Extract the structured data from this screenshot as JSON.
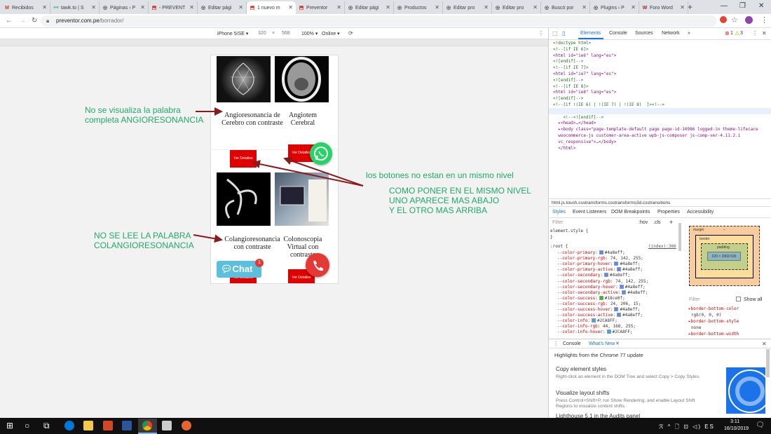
{
  "browser": {
    "tabs": [
      {
        "label": "Recibidos",
        "favicon": "M",
        "active": false
      },
      {
        "label": "tawk.to | S",
        "favicon": "tawk",
        "active": false
      },
      {
        "label": "Páginas ‹ P",
        "favicon": "wp",
        "active": false
      },
      {
        "label": "- PREVENT",
        "favicon": "prev",
        "active": false
      },
      {
        "label": "Editar pági",
        "favicon": "wp",
        "active": false
      },
      {
        "label": "1 nuevo m",
        "favicon": "prev",
        "active": true
      },
      {
        "label": "Preventor",
        "favicon": "prev",
        "active": false
      },
      {
        "label": "Editar pági",
        "favicon": "wp",
        "active": false
      },
      {
        "label": "Productos",
        "favicon": "wp",
        "active": false
      },
      {
        "label": "Editar pro",
        "favicon": "wp",
        "active": false
      },
      {
        "label": "Editar pro",
        "favicon": "wp",
        "active": false
      },
      {
        "label": "Buscó por",
        "favicon": "wp",
        "active": false
      },
      {
        "label": "Plugins ‹ P",
        "favicon": "wp",
        "active": false
      },
      {
        "label": "Foro Word",
        "favicon": "W",
        "active": false
      }
    ],
    "url_domain": "preventor.com.pe",
    "url_path": "/borrador/"
  },
  "device_toolbar": {
    "device": "iPhone 5/SE ▾",
    "width": "320",
    "height": "568",
    "zoom": "100% ▾",
    "network": "Online ▾"
  },
  "products": [
    {
      "title": "Angioresonancia de Cerebro con contraste",
      "button": "Ver Detalles"
    },
    {
      "title": "Angiotem Cerebral",
      "button": "Ver Detalles"
    },
    {
      "title": "Colangioresonancia con contraste",
      "button": "Ver Detalles"
    },
    {
      "title": "Colonoscopia Virtual con contraste",
      "button": "Ver Detalles"
    }
  ],
  "chat_widget": {
    "label": "Chat",
    "badge": "1"
  },
  "annotations": {
    "a1": "No se visualiza la palabra\ncompleta ANGIORESONANCIA",
    "a2": "los botones no estan en un mismo nivel",
    "a3": "COMO PONER EN EL MISMO NIVEL\nUNO APARECE MAS ABAJO\nY EL OTRO MAS ARRIBA",
    "a4": "NO SE LEE LA PALABRA\nCOLANGIORESONANCIA"
  },
  "devtools": {
    "tabs": [
      "Elements",
      "Console",
      "Sources",
      "Network",
      "»"
    ],
    "errors": "1",
    "warnings": "3",
    "dom_lines": [
      "<!doctype html>",
      "<!--[if IE 6]>",
      "<html id=\"ie6\" lang=\"es\">",
      "<![endif]-->",
      "<!--[if IE 7]>",
      "<html id=\"ie7\" lang=\"es\">",
      "<![endif]-->",
      "<!--[if IE 8]>",
      "<html id=\"ie8\" lang=\"es\">",
      "<![endif]-->",
      "<!--[if !(IE 6) | !(IE 7) | !(IE 8)  ]><!-->",
      "…<html lang=\"es\" class=\" js touch csstransforms csstransforms3d csstransitions\"> == $0",
      "    <!--<![endif]-->",
      "  ▸<head>…</head>",
      "  ▸<body class=\"page-template-default page page-id-10986 logged-in theme-lifecare",
      "  woocommerce-js customer-area-active wpb-js-composer js-comp-ver-4.11.2.1",
      "  vc_responsive\">…</body>",
      "  </html>"
    ],
    "breadcrumb": "html.js.touch.csstransforms.csstransforms3d.csstransitions",
    "style_tabs": [
      "Styles",
      "Event Listeners",
      "DOM Breakpoints",
      "Properties",
      "Accessibility"
    ],
    "filter_placeholder": "Filter",
    "hov": ":hov",
    "cls": ".cls",
    "element_style": "element.style {",
    "root_selector": ":root {",
    "root_source": "(index):366",
    "css_vars": [
      {
        "name": "--color-primary:",
        "value": "#4a8eff;",
        "color": "#4a8eff"
      },
      {
        "name": "--color-primary-rgb:",
        "value": "74, 142, 255;",
        "color": ""
      },
      {
        "name": "--color-primary-hover:",
        "value": "#4a8eff;",
        "color": "#4a8eff"
      },
      {
        "name": "--color-primary-active:",
        "value": "#4a8eff;",
        "color": "#4a8eff"
      },
      {
        "name": "--color-secondary:",
        "value": "#4a8eff;",
        "color": "#4a8eff"
      },
      {
        "name": "--color-secondary-rgb:",
        "value": "74, 142, 255;",
        "color": ""
      },
      {
        "name": "--color-secondary-hover:",
        "value": "#4a8eff;",
        "color": "#4a8eff"
      },
      {
        "name": "--color-secondary-active:",
        "value": "#4a8eff;",
        "color": "#4a8eff"
      },
      {
        "name": "--color-success:",
        "value": "#18ce0f;",
        "color": "#18ce0f"
      },
      {
        "name": "--color-success-rgb:",
        "value": "24, 206, 15;",
        "color": ""
      },
      {
        "name": "--color-success-hover:",
        "value": "#4a8eff;",
        "color": "#4a8eff"
      },
      {
        "name": "--color-success-active:",
        "value": "#4a8eff;",
        "color": "#4a8eff"
      },
      {
        "name": "--color-info:",
        "value": "#2CA8FF;",
        "color": "#2CA8FF"
      },
      {
        "name": "--color-info-rgb:",
        "value": "44, 168, 255;",
        "color": ""
      },
      {
        "name": "--color-info-hover:",
        "value": "#2CA8FF;",
        "color": "#2CA8FF"
      }
    ],
    "box_model": {
      "margin": "margin",
      "border": "border",
      "padding": "padding",
      "content": "320 × 2969.530",
      "dash": "–"
    },
    "computed_filter": "Filter",
    "show_all": "Show all",
    "computed_props": [
      {
        "name": "border-bottom-color",
        "value": "rgb(0, 0, 0)"
      },
      {
        "name": "border-bottom-style",
        "value": "none"
      },
      {
        "name": "border-bottom-width",
        "value": ""
      }
    ],
    "drawer_tabs": [
      "Console",
      "What's New"
    ],
    "drawer_headline": "Highlights from the Chrome 77 update",
    "whats_new": [
      {
        "title": "Copy element styles",
        "desc": "Right-click an element in the DOM Tree and select Copy > Copy Styles."
      },
      {
        "title": "Visualize layout shifts",
        "desc": "Press Control+Shift+P, run Show Rendering, and enable Layout Shift Regions to visualize content shifts."
      },
      {
        "title": "Lighthouse 5.1 in the Audits panel",
        "desc": ""
      }
    ]
  },
  "taskbar": {
    "time": "3:11",
    "date": "16/10/2019",
    "tray": "ℛ ^ 🗋 ⊡ ◁) ES"
  }
}
